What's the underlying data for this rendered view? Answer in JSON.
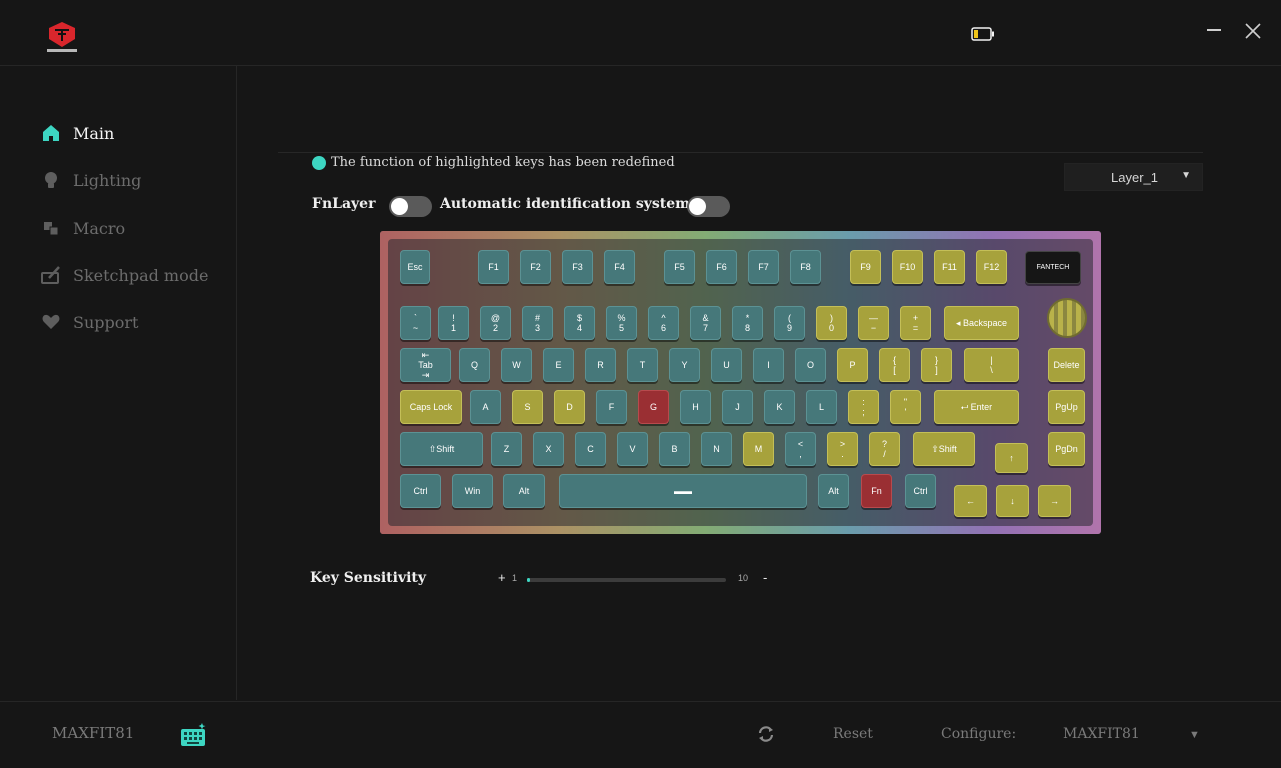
{
  "window": {
    "brand": "FANTECH"
  },
  "sidebar": {
    "items": [
      {
        "label": "Main",
        "icon": "home-icon",
        "active": true
      },
      {
        "label": "Lighting",
        "icon": "bulb-icon",
        "active": false
      },
      {
        "label": "Macro",
        "icon": "macro-icon",
        "active": false
      },
      {
        "label": "Sketchpad mode",
        "icon": "sketchpad-icon",
        "active": false
      },
      {
        "label": "Support",
        "icon": "heart-icon",
        "active": false
      }
    ]
  },
  "main": {
    "notice": "The function of highlighted keys has been redefined",
    "layer_select": {
      "value": "Layer_1",
      "arrow": "▼"
    },
    "fn_layer_label": "FnLayer",
    "fn_layer_on": false,
    "auto_id_label": "Automatic identification system",
    "auto_id_on": false,
    "screen_brand": "FANTECH"
  },
  "keyboard": {
    "colors": {
      "teal": "#46787a",
      "yellow": "#a7a23c",
      "red": "#9a2f33",
      "accent": "#3dd6c2"
    },
    "keys": [
      {
        "id": "esc",
        "label": "Esc",
        "color": "teal"
      },
      {
        "id": "f1",
        "label": "F1",
        "color": "teal"
      },
      {
        "id": "f2",
        "label": "F2",
        "color": "teal"
      },
      {
        "id": "f3",
        "label": "F3",
        "color": "teal"
      },
      {
        "id": "f4",
        "label": "F4",
        "color": "teal"
      },
      {
        "id": "f5",
        "label": "F5",
        "color": "teal"
      },
      {
        "id": "f6",
        "label": "F6",
        "color": "teal"
      },
      {
        "id": "f7",
        "label": "F7",
        "color": "teal"
      },
      {
        "id": "f8",
        "label": "F8",
        "color": "teal"
      },
      {
        "id": "f9",
        "label": "F9",
        "color": "yellow"
      },
      {
        "id": "f10",
        "label": "F10",
        "color": "yellow"
      },
      {
        "id": "f11",
        "label": "F11",
        "color": "yellow"
      },
      {
        "id": "f12",
        "label": "F12",
        "color": "yellow"
      },
      {
        "id": "grave",
        "label": "`\n~",
        "color": "teal"
      },
      {
        "id": "1",
        "label": "!\n1",
        "color": "teal"
      },
      {
        "id": "2",
        "label": "@\n2",
        "color": "teal"
      },
      {
        "id": "3",
        "label": "#\n3",
        "color": "teal"
      },
      {
        "id": "4",
        "label": "$\n4",
        "color": "teal"
      },
      {
        "id": "5",
        "label": "%\n5",
        "color": "teal"
      },
      {
        "id": "6",
        "label": "^\n6",
        "color": "teal"
      },
      {
        "id": "7",
        "label": "&\n7",
        "color": "teal"
      },
      {
        "id": "8",
        "label": "*\n8",
        "color": "teal"
      },
      {
        "id": "9",
        "label": "(\n9",
        "color": "teal"
      },
      {
        "id": "0",
        "label": ")\n0",
        "color": "yellow"
      },
      {
        "id": "minus",
        "label": "—\n−",
        "color": "yellow"
      },
      {
        "id": "equal",
        "label": "+\n=",
        "color": "yellow"
      },
      {
        "id": "backspace",
        "label": "◂ Backspace",
        "color": "yellow"
      },
      {
        "id": "tab",
        "label": "⇤\nTab\n⇥",
        "color": "teal"
      },
      {
        "id": "q",
        "label": "Q",
        "color": "teal"
      },
      {
        "id": "w",
        "label": "W",
        "color": "teal"
      },
      {
        "id": "e",
        "label": "E",
        "color": "teal"
      },
      {
        "id": "r",
        "label": "R",
        "color": "teal"
      },
      {
        "id": "t",
        "label": "T",
        "color": "teal"
      },
      {
        "id": "y",
        "label": "Y",
        "color": "teal"
      },
      {
        "id": "u",
        "label": "U",
        "color": "teal"
      },
      {
        "id": "i",
        "label": "I",
        "color": "teal"
      },
      {
        "id": "o",
        "label": "O",
        "color": "teal"
      },
      {
        "id": "p",
        "label": "P",
        "color": "yellow"
      },
      {
        "id": "lbracket",
        "label": "{\n[",
        "color": "yellow"
      },
      {
        "id": "rbracket",
        "label": "}\n]",
        "color": "yellow"
      },
      {
        "id": "backslash",
        "label": "|\n\\",
        "color": "yellow"
      },
      {
        "id": "delete",
        "label": "Delete",
        "color": "yellow"
      },
      {
        "id": "capslock",
        "label": "Caps Lock",
        "color": "yellow"
      },
      {
        "id": "a",
        "label": "A",
        "color": "teal"
      },
      {
        "id": "s",
        "label": "S",
        "color": "yellow"
      },
      {
        "id": "d",
        "label": "D",
        "color": "yellow"
      },
      {
        "id": "f",
        "label": "F",
        "color": "teal"
      },
      {
        "id": "g",
        "label": "G",
        "color": "red"
      },
      {
        "id": "h",
        "label": "H",
        "color": "teal"
      },
      {
        "id": "j",
        "label": "J",
        "color": "teal"
      },
      {
        "id": "k",
        "label": "K",
        "color": "teal"
      },
      {
        "id": "l",
        "label": "L",
        "color": "teal"
      },
      {
        "id": "semicolon",
        "label": ":\n;",
        "color": "yellow"
      },
      {
        "id": "quote",
        "label": "\"\n'",
        "color": "yellow"
      },
      {
        "id": "enter",
        "label": "⮠ Enter",
        "color": "yellow"
      },
      {
        "id": "pgup",
        "label": "PgUp",
        "color": "yellow"
      },
      {
        "id": "lshift",
        "label": "⇧Shift",
        "color": "teal"
      },
      {
        "id": "z",
        "label": "Z",
        "color": "teal"
      },
      {
        "id": "x",
        "label": "X",
        "color": "teal"
      },
      {
        "id": "c",
        "label": "C",
        "color": "teal"
      },
      {
        "id": "v",
        "label": "V",
        "color": "teal"
      },
      {
        "id": "b",
        "label": "B",
        "color": "teal"
      },
      {
        "id": "n",
        "label": "N",
        "color": "teal"
      },
      {
        "id": "m",
        "label": "M",
        "color": "yellow"
      },
      {
        "id": "comma",
        "label": "<\n,",
        "color": "teal"
      },
      {
        "id": "period",
        "label": ">\n.",
        "color": "yellow"
      },
      {
        "id": "slash",
        "label": "?\n/",
        "color": "yellow"
      },
      {
        "id": "rshift",
        "label": "⇧Shift",
        "color": "yellow"
      },
      {
        "id": "up",
        "label": "↑",
        "color": "yellow"
      },
      {
        "id": "pgdn",
        "label": "PgDn",
        "color": "yellow"
      },
      {
        "id": "lctrl",
        "label": "Ctrl",
        "color": "teal"
      },
      {
        "id": "win",
        "label": "Win",
        "color": "teal"
      },
      {
        "id": "lalt",
        "label": "Alt",
        "color": "teal"
      },
      {
        "id": "space",
        "label": "▬▬",
        "color": "teal"
      },
      {
        "id": "ralt",
        "label": "Alt",
        "color": "teal"
      },
      {
        "id": "fn",
        "label": "Fn",
        "color": "red"
      },
      {
        "id": "rctrl",
        "label": "Ctrl",
        "color": "teal"
      },
      {
        "id": "left",
        "label": "←",
        "color": "yellow"
      },
      {
        "id": "down",
        "label": "↓",
        "color": "yellow"
      },
      {
        "id": "right",
        "label": "→",
        "color": "yellow"
      }
    ]
  },
  "sensitivity": {
    "label": "Key Sensitivity",
    "plus": "+",
    "minus": "-",
    "min_label": "1",
    "max_label": "10",
    "min": 1,
    "max": 10,
    "value": 1
  },
  "footer": {
    "device_name": "MAXFIT81",
    "reset_label": "Reset",
    "configure_label": "Configure:",
    "profile_value": "MAXFIT81",
    "profile_arrow": "▼"
  }
}
